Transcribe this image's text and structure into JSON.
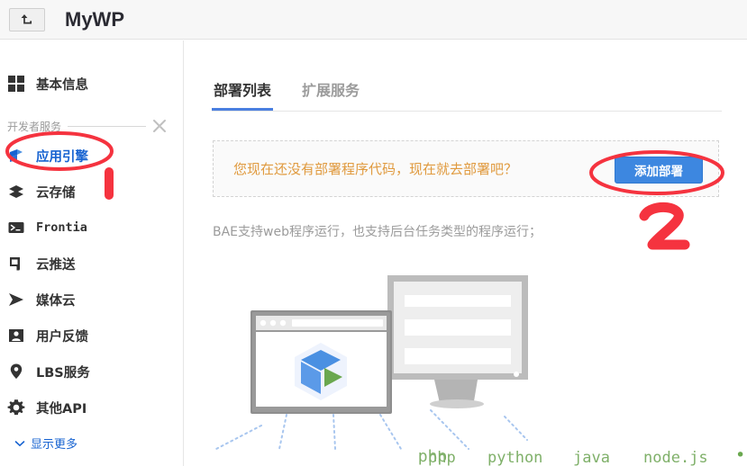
{
  "header": {
    "back_icon": "return-arrow-icon",
    "brand": "MyWP"
  },
  "sidebar": {
    "basic": {
      "label": "基本信息",
      "icon": "grid-icon"
    },
    "group": {
      "label": "开发者服务",
      "tool_icon": "tools-icon"
    },
    "items": [
      {
        "label": "应用引擎",
        "icon": "app-engine-icon",
        "active": true
      },
      {
        "label": "云存储",
        "icon": "layers-icon",
        "active": false
      },
      {
        "label": "Frontia",
        "icon": "terminal-icon",
        "active": false
      },
      {
        "label": "云推送",
        "icon": "megaphone-icon",
        "active": false
      },
      {
        "label": "媒体云",
        "icon": "play-media-icon",
        "active": false
      },
      {
        "label": "用户反馈",
        "icon": "user-feedback-icon",
        "active": false
      },
      {
        "label": "LBS服务",
        "icon": "location-pin-icon",
        "active": false
      },
      {
        "label": "其他API",
        "icon": "gear-icon",
        "active": false
      }
    ],
    "show_more": {
      "label": "显示更多",
      "icon": "chevron-down-icon"
    }
  },
  "main": {
    "tabs": [
      {
        "label": "部署列表",
        "selected": true
      },
      {
        "label": "扩展服务",
        "selected": false
      }
    ],
    "notice": {
      "text": "您现在还没有部署程序代码，现在就去部署吧？",
      "button_label": "添加部署"
    },
    "description": "BAE支持web程序运行，也支持后台任务类型的程序运行；",
    "illustration": {
      "languages": [
        "php",
        "python",
        "java",
        "node.js"
      ],
      "ellipsis": "•••"
    }
  },
  "annotations": [
    {
      "name": "step-1-marker",
      "label": "1"
    },
    {
      "name": "step-2-marker",
      "label": "2"
    }
  ],
  "colors": {
    "accent_blue": "#1763d1",
    "button_blue": "#3d87e0",
    "notice_orange": "#e09a3e",
    "annotation_red": "#f5333f",
    "lang_green": "#7fb069",
    "muted_gray": "#9b9b9b"
  }
}
